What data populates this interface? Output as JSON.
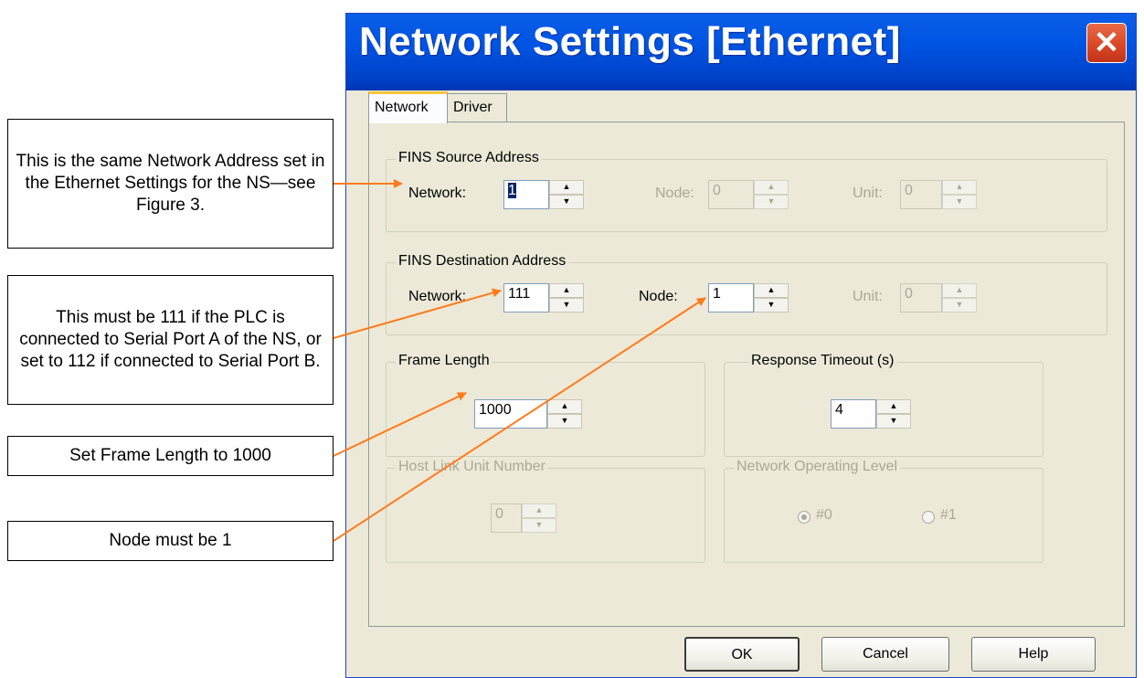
{
  "dialog": {
    "title": "Network Settings [Ethernet]",
    "close_icon": "close-icon"
  },
  "tabs": [
    {
      "label": "Network",
      "active": true
    },
    {
      "label": "Driver",
      "active": false
    }
  ],
  "fins_source": {
    "legend": "FINS Source Address",
    "network": {
      "label": "Network:",
      "value": "1"
    },
    "node": {
      "label": "Node:",
      "value": "0",
      "enabled": false
    },
    "unit": {
      "label": "Unit:",
      "value": "0",
      "enabled": false
    }
  },
  "fins_destination": {
    "legend": "FINS Destination Address",
    "network": {
      "label": "Network:",
      "value": "111"
    },
    "node": {
      "label": "Node:",
      "value": "1"
    },
    "unit": {
      "label": "Unit:",
      "value": "0",
      "enabled": false
    }
  },
  "frame_length": {
    "legend": "Frame Length",
    "value": "1000"
  },
  "response_timeout": {
    "legend": "Response Timeout (s)",
    "value": "4"
  },
  "host_link": {
    "legend": "Host Link Unit Number",
    "value": "0",
    "enabled": false
  },
  "network_level": {
    "legend": "Network Operating Level",
    "enabled": false,
    "options": [
      {
        "label": "#0",
        "selected": true
      },
      {
        "label": "#1",
        "selected": false
      }
    ]
  },
  "buttons": {
    "ok": "OK",
    "cancel": "Cancel",
    "help": "Help"
  },
  "callouts": [
    {
      "text": "This is the same Network Address set in the Ethernet Settings for the NS—see Figure 3."
    },
    {
      "text": "This must be 111 if the PLC is connected to Serial Port A of the NS, or set to 112 if connected to Serial Port B."
    },
    {
      "text": "Set Frame Length to 1000"
    },
    {
      "text": "Node must be 1"
    }
  ],
  "annotation_color": "#ff7b1c"
}
